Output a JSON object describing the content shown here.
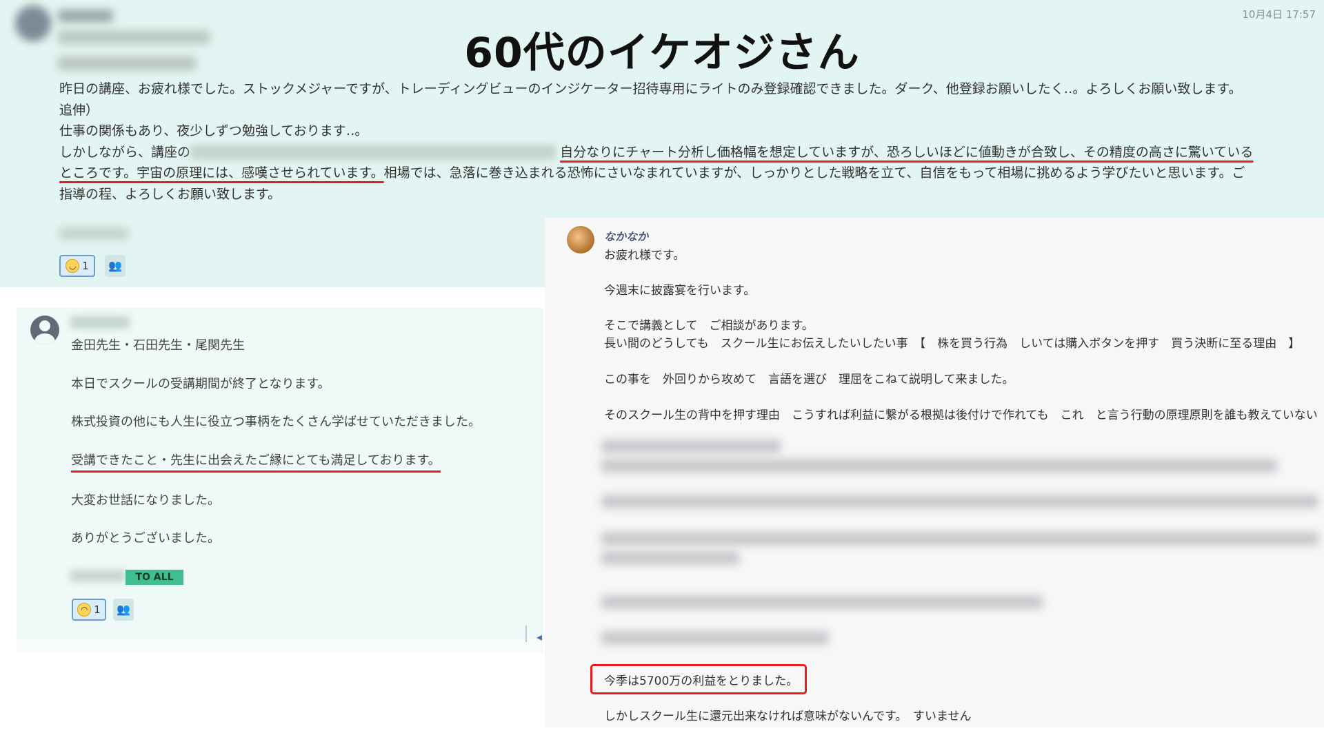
{
  "header": {
    "title": "60代のイケオジさん",
    "timestamp": "10月4日 17:57"
  },
  "top_message": {
    "p1": "昨日の講座、お疲れ様でした。ストックメジャーですが、トレーディングビューのインジケーター招待専用にライトのみ登録確認できました。ダーク、他登録お願いしたく‥。よろしくお願い致します。",
    "p2": "追伸）",
    "p3": "仕事の関係もあり、夜少しずつ勉強しております‥。",
    "p4_a": "しかしながら、講座の",
    "p4_ul": "自分なりにチャート分析し価格幅を想定していますが、恐ろしいほどに値動きが合致し、その精度の高さに驚いているところです。宇宙の原理には、感嘆させられています。",
    "p4_b": "相場では、急落に巻き込まれる恐怖にさいなまれていますが、しっかりとした戦略を立て、自信をもって相場に挑めるよう学びたいと思います。ご指導の程、よろしくお願い致します。",
    "reaction_count": "1"
  },
  "left_message": {
    "greeting": "金田先生・石田先生・尾関先生",
    "line1": "本日でスクールの受講期間が終了となります。",
    "line2": "株式投資の他にも人生に役立つ事柄をたくさん学ばせていただきました。",
    "line3": "受講できたこと・先生に出会えたご縁にとても満足しております。",
    "line4": "大変お世話になりました。",
    "line5": "ありがとうございました。",
    "to_all": "TO ALL",
    "reaction_count": "1"
  },
  "right_message": {
    "name": "なかなか",
    "line1": "お疲れ様です。",
    "line2": "今週末に披露宴を行います。",
    "line3": "そこで講義として　ご相談があります。",
    "line4": "長い間のどうしても　スクール生にお伝えしたいしたい事　【　株を買う行為　しいては購入ボタンを押す　買う決断に至る理由　】",
    "line5": "この事を　外回りから攻めて　言語を選び　理屈をこねて説明して来ました。",
    "line6": "そのスクール生の背中を押す理由　こうすれば利益に繋がる根拠は後付けで作れても　これ　と言う行動の原理原則を誰も教えていない",
    "line7": "今季は5700万の利益をとりました。",
    "line8": "しかしスクール生に還元出来なければ意味がないんです。　すいません"
  },
  "colors": {
    "top_bg": "#e3f5f2",
    "left_bg": "#eef9f8",
    "right_bg": "#f7f7f8",
    "highlight_red": "#e02020",
    "to_all_green": "#3fbf8f"
  }
}
